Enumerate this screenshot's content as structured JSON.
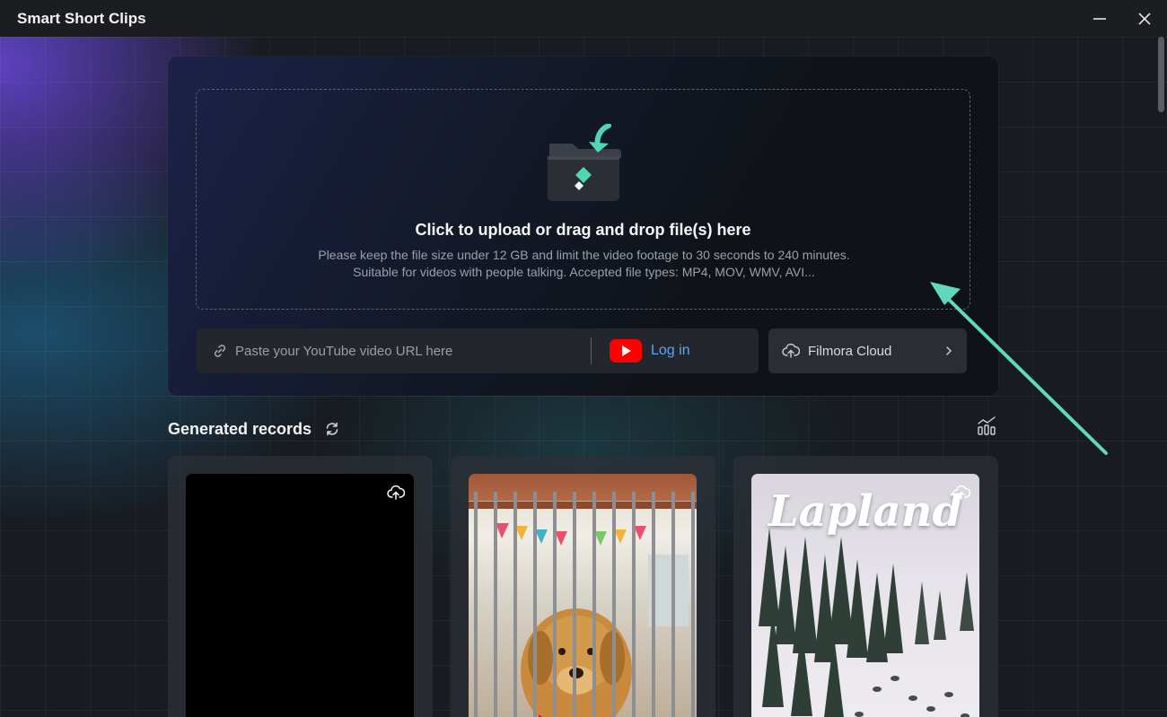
{
  "window": {
    "title": "Smart Short Clips"
  },
  "upload": {
    "title": "Click to upload or drag and drop file(s) here",
    "description": "Please keep the file size under 12 GB and limit the video footage to 30 seconds to 240 minutes. Suitable for videos with people talking. Accepted file types: MP4, MOV, WMV, AVI...",
    "url_placeholder": "Paste your YouTube video URL here",
    "login_label": "Log in",
    "cloud_label": "Filmora Cloud"
  },
  "records": {
    "title": "Generated records",
    "items": [
      {
        "thumbnail": "black-frame",
        "overlay_text": ""
      },
      {
        "thumbnail": "dog-in-kennel",
        "overlay_text": ""
      },
      {
        "thumbnail": "snowy-forest",
        "overlay_text": "Lapland"
      }
    ]
  },
  "icons": {
    "minimize": "minimize-icon",
    "close": "close-icon",
    "folder": "folder-upload-icon",
    "link": "link-icon",
    "youtube": "youtube-icon",
    "cloud": "cloud-upload-icon",
    "chevron": "chevron-right-icon",
    "refresh": "refresh-icon",
    "analytics": "analytics-icon"
  },
  "colors": {
    "accent_teal": "#4fd6b3",
    "link_blue": "#57a6ff",
    "youtube_red": "#ff0000",
    "annotation_arrow": "#5fd9bd"
  }
}
